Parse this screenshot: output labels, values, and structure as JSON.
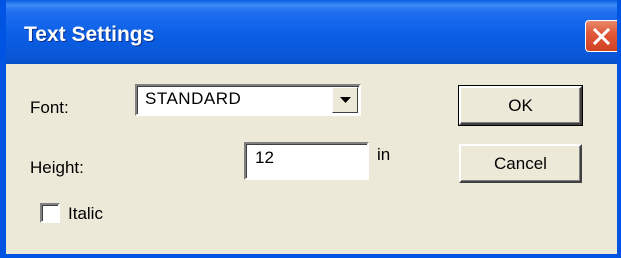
{
  "window": {
    "title": "Text Settings"
  },
  "font": {
    "label": "Font:",
    "selected": "STANDARD"
  },
  "height": {
    "label": "Height:",
    "value": "12",
    "unit": "in"
  },
  "italic": {
    "label": "Italic",
    "checked": false
  },
  "buttons": {
    "ok": "OK",
    "cancel": "Cancel"
  },
  "colors": {
    "titlebar": "#0a5ee0",
    "dialog_bg": "#ece9d8",
    "close_button": "#e0593a"
  },
  "icons": {
    "close": "close-icon",
    "dropdown": "chevron-down-icon"
  }
}
